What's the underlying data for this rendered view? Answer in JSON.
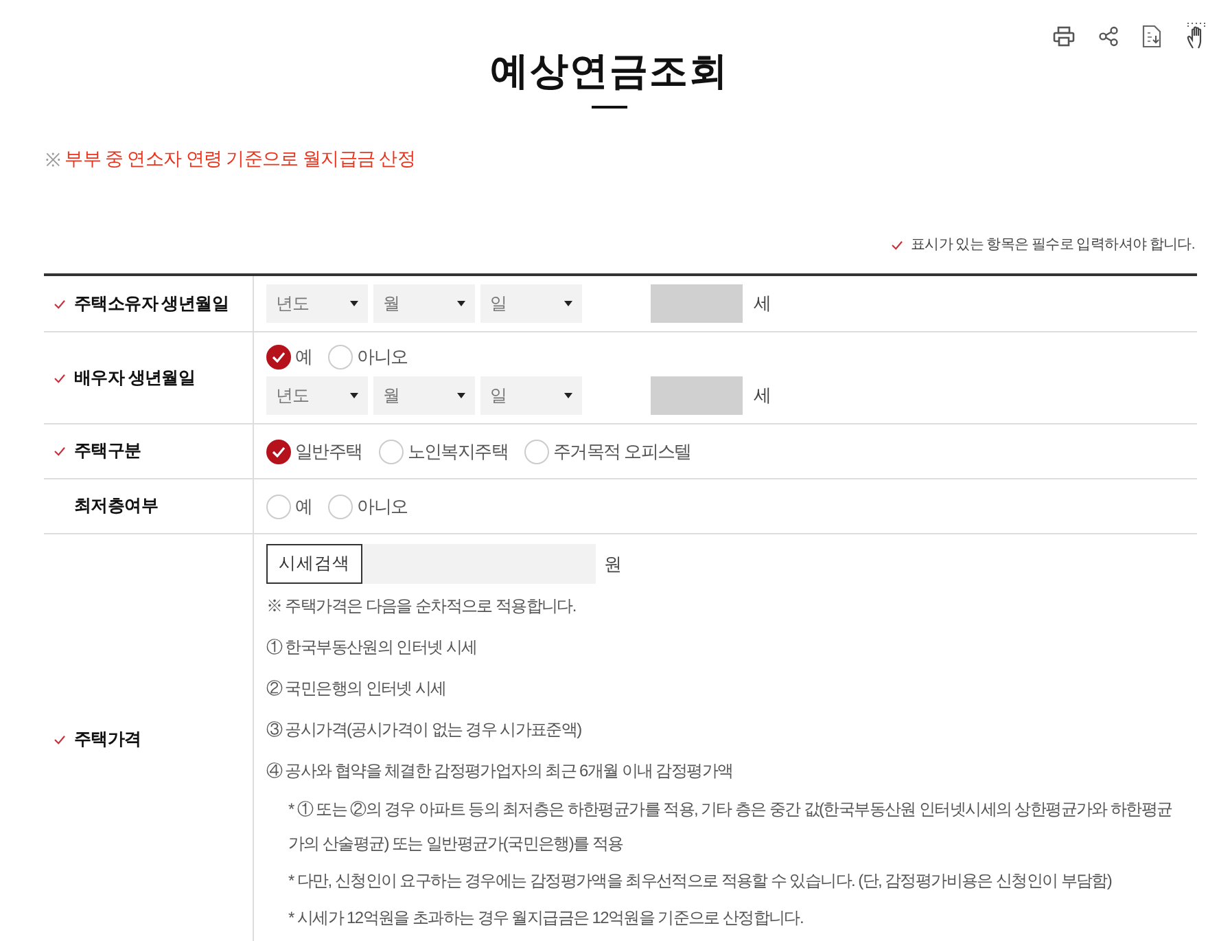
{
  "title": "예상연금조회",
  "notice": {
    "mark": "※",
    "text": "부부 중 연소자 연령 기준으로 월지급금 산정"
  },
  "required_note": "표시가 있는 항목은 필수로 입력하셔야 합니다.",
  "rows": [
    {
      "kind": "date",
      "label": "주택소유자 생년월일",
      "required": true,
      "selects": [
        "년도",
        "월",
        "일"
      ],
      "age_unit": "세"
    },
    {
      "kind": "spouse",
      "label": "배우자 생년월일",
      "required": true,
      "options": [
        {
          "label": "예",
          "selected": true
        },
        {
          "label": "아니오",
          "selected": false
        }
      ],
      "selects": [
        "년도",
        "월",
        "일"
      ],
      "age_unit": "세"
    },
    {
      "kind": "radio",
      "label": "주택구분",
      "required": true,
      "options": [
        {
          "label": "일반주택",
          "selected": true
        },
        {
          "label": "노인복지주택",
          "selected": false
        },
        {
          "label": "주거목적 오피스텔",
          "selected": false
        }
      ]
    },
    {
      "kind": "radio",
      "label": "최저층여부",
      "required": false,
      "options": [
        {
          "label": "예",
          "selected": false
        },
        {
          "label": "아니오",
          "selected": false
        }
      ]
    },
    {
      "kind": "price",
      "label": "주택가격",
      "required": true,
      "button": "시세검색",
      "unit": "원",
      "intro": "※ 주택가격은 다음을 순차적으로 적용합니다.",
      "steps": [
        "① 한국부동산원의 인터넷 시세",
        "② 국민은행의 인터넷 시세",
        "③ 공시가격(공시가격이 없는 경우 시가표준액)",
        "④ 공사와 협약을 체결한 감정평가업자의 최근 6개월 이내 감정평가액"
      ],
      "notes": [
        "* ① 또는 ②의 경우 아파트 등의 최저층은 하한평균가를 적용, 기타 층은 중간 값(한국부동산원 인터넷시세의 상한평균가와 하한평균가의 산술평균) 또는 일반평균가(국민은행)를 적용",
        "* 다만, 신청인이 요구하는 경우에는 감정평가액을 최우선적으로 적용할 수 있습니다. (단, 감정평가비용은 신청인이 부담함)",
        "* 시세가 12억원을 초과하는 경우 월지급금은 12억원을 기준으로 산정합니다."
      ]
    }
  ]
}
